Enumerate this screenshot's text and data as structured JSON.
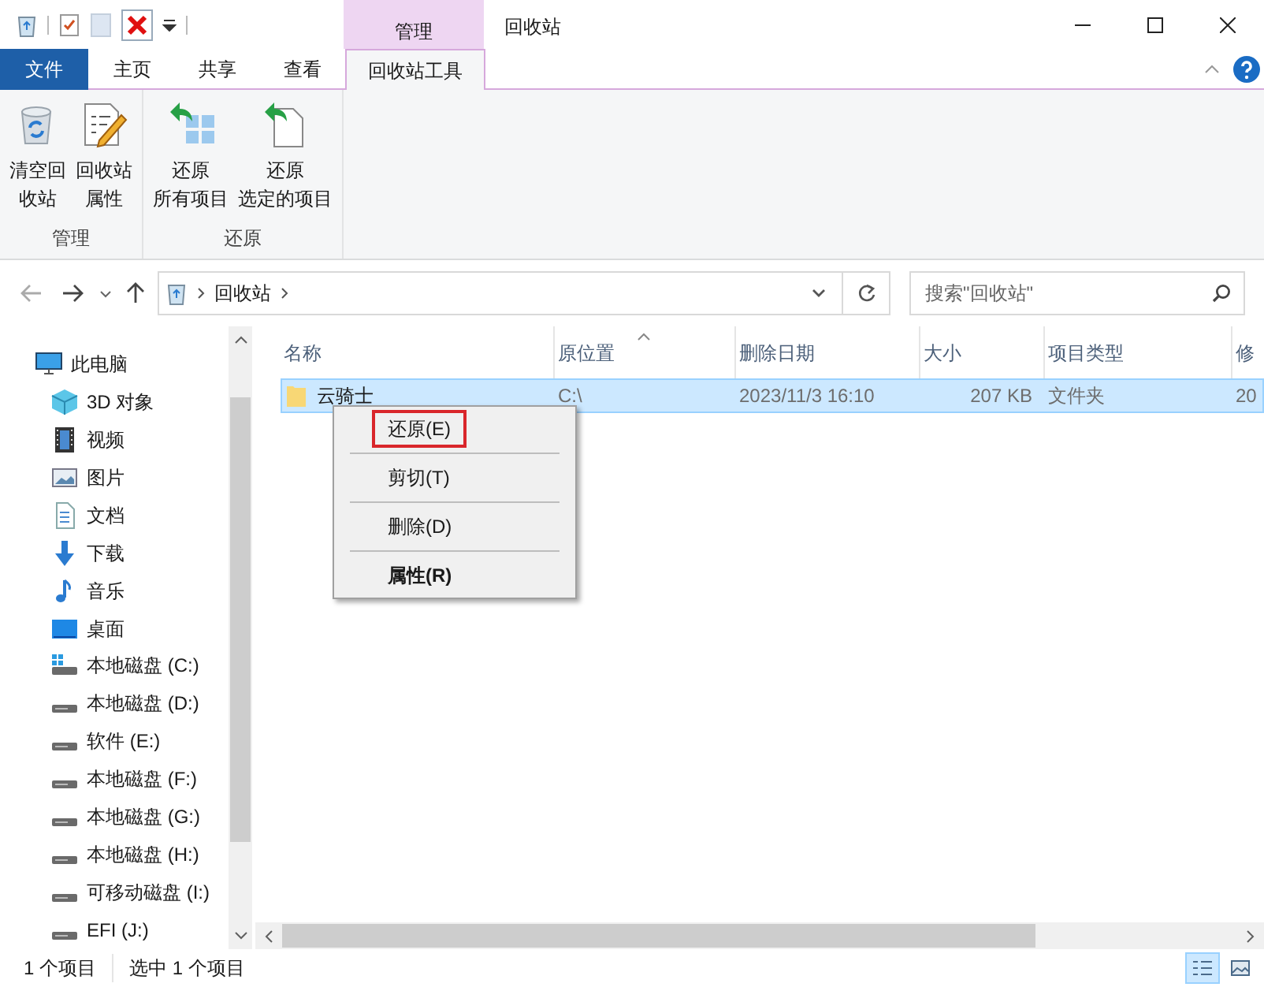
{
  "window": {
    "title": "回收站",
    "context_tab_group": "管理"
  },
  "ribbon_tabs": [
    {
      "label": "文件",
      "kind": "file",
      "selected": false
    },
    {
      "label": "主页",
      "kind": "tab",
      "selected": false
    },
    {
      "label": "共享",
      "kind": "tab",
      "selected": false
    },
    {
      "label": "查看",
      "kind": "tab",
      "selected": false
    },
    {
      "label": "回收站工具",
      "kind": "tab",
      "selected": true
    }
  ],
  "ribbon_groups": [
    {
      "label": "管理",
      "commands": [
        {
          "lines": [
            "清空回",
            "收站"
          ],
          "kind": "empty-bin"
        },
        {
          "lines": [
            "回收站",
            "属性"
          ],
          "kind": "properties"
        }
      ]
    },
    {
      "label": "还原",
      "commands": [
        {
          "lines": [
            "还原",
            "所有项目"
          ],
          "kind": "restore-all"
        },
        {
          "lines": [
            "还原",
            "选定的项目"
          ],
          "kind": "restore-selected"
        }
      ]
    }
  ],
  "address_bar": {
    "path": "回收站"
  },
  "search": {
    "placeholder": "搜索\"回收站\""
  },
  "sidebar": {
    "items": [
      {
        "label": "此电脑",
        "kind": "pc",
        "children": [
          {
            "label": "3D 对象",
            "kind": "objects"
          },
          {
            "label": "视频",
            "kind": "video"
          },
          {
            "label": "图片",
            "kind": "pictures"
          },
          {
            "label": "文档",
            "kind": "docs"
          },
          {
            "label": "下载",
            "kind": "downloads"
          },
          {
            "label": "音乐",
            "kind": "music"
          },
          {
            "label": "桌面",
            "kind": "desktop"
          },
          {
            "label": "本地磁盘 (C:)",
            "kind": "system-drive"
          },
          {
            "label": "本地磁盘 (D:)",
            "kind": "drive"
          },
          {
            "label": "软件 (E:)",
            "kind": "drive"
          },
          {
            "label": "本地磁盘 (F:)",
            "kind": "drive"
          },
          {
            "label": "本地磁盘 (G:)",
            "kind": "drive"
          },
          {
            "label": "本地磁盘 (H:)",
            "kind": "drive"
          },
          {
            "label": "可移动磁盘 (I:)",
            "kind": "drive"
          },
          {
            "label": "EFI (J:)",
            "kind": "drive"
          }
        ]
      }
    ]
  },
  "table": {
    "columns": [
      "名称",
      "原位置",
      "删除日期",
      "大小",
      "项目类型",
      "修"
    ],
    "rows": [
      {
        "cells": [
          "云骑士",
          "C:\\",
          "2023/11/3 16:10",
          "207 KB",
          "文件夹",
          "20"
        ],
        "selected": true
      }
    ]
  },
  "context_menu": {
    "items": [
      {
        "label": "还原(E)",
        "selected": true,
        "default": false
      },
      {
        "label": "剪切(T)",
        "selected": false,
        "default": false
      },
      {
        "label": "删除(D)",
        "selected": false,
        "default": false
      },
      {
        "label": "属性(R)",
        "selected": false,
        "default": true
      }
    ]
  },
  "status_bar": {
    "item_count": "1 个项目",
    "selection": "选中 1 个项目"
  }
}
